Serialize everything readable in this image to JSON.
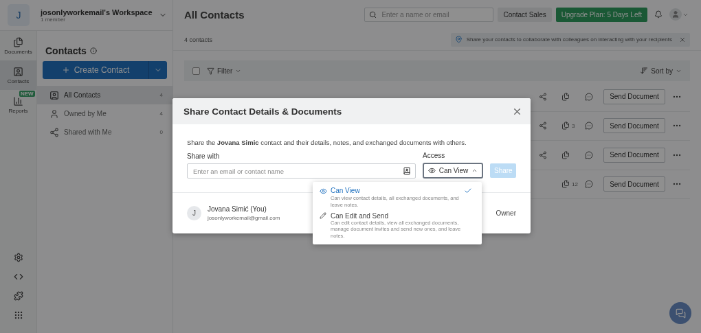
{
  "workspace": {
    "initial": "J",
    "name": "josonlyworkemail's Workspace",
    "members": "1 member"
  },
  "rail": {
    "items": [
      {
        "kind": "documents",
        "label": "Documents",
        "selected": false
      },
      {
        "kind": "contacts",
        "label": "Contacts",
        "selected": true
      },
      {
        "kind": "reports",
        "label": "Reports",
        "selected": false,
        "badge": "NEW"
      }
    ]
  },
  "sidebar": {
    "title": "Contacts",
    "create_button": "Create Contact",
    "items": [
      {
        "kind": "all",
        "label": "All Contacts",
        "count": "4",
        "selected": true
      },
      {
        "kind": "owned",
        "label": "Owned by Me",
        "count": "4",
        "selected": false
      },
      {
        "kind": "shared",
        "label": "Shared with Me",
        "count": "0",
        "selected": false
      }
    ]
  },
  "header": {
    "title": "All Contacts",
    "search": {
      "placeholder": "Enter a name or email"
    },
    "contact_sales": "Contact Sales",
    "upgrade": "Upgrade Plan: 5 Days Left"
  },
  "summary": {
    "count": "4 contacts",
    "tip": "Share your contacts to collaborate with colleagues on interacting with your recipients"
  },
  "toolbar": {
    "select_all_checked": false,
    "filter": "Filter",
    "sort": "Sort by"
  },
  "rows": [
    {
      "shared": true,
      "send": "Send Document"
    },
    {
      "shared": true,
      "doc_count": "3",
      "send": "Send Document"
    },
    {
      "shared": true,
      "send": "Send Document"
    },
    {
      "shared": false,
      "doc_count": "12",
      "send": "Send Document"
    }
  ],
  "modal": {
    "title": "Share Contact Details & Documents",
    "description": "Share the **Jovana Simic** contact and their details, notes, and exchanged documents with others.",
    "share_with_label": "Share with",
    "share_with_placeholder": "Enter an email or contact name",
    "access_label": "Access",
    "access": {
      "value": "Can View",
      "expanded": true
    },
    "share_button": {
      "label": "Share",
      "disabled": true
    },
    "members": [
      {
        "initial": "J",
        "name": "Jovana Simić (You)",
        "email": "josonlyworkemail@gmail.com",
        "role": "Owner"
      }
    ],
    "access_options": [
      {
        "kind": "view",
        "label": "Can View",
        "description": "Can view contact details, all exchanged documents, and leave notes.",
        "selected": true
      },
      {
        "kind": "edit",
        "label": "Can Edit and Send",
        "description": "Can edit contact details, view all exchanged documents, manage document invites and send new ones, and leave notes.",
        "selected": false
      }
    ]
  }
}
